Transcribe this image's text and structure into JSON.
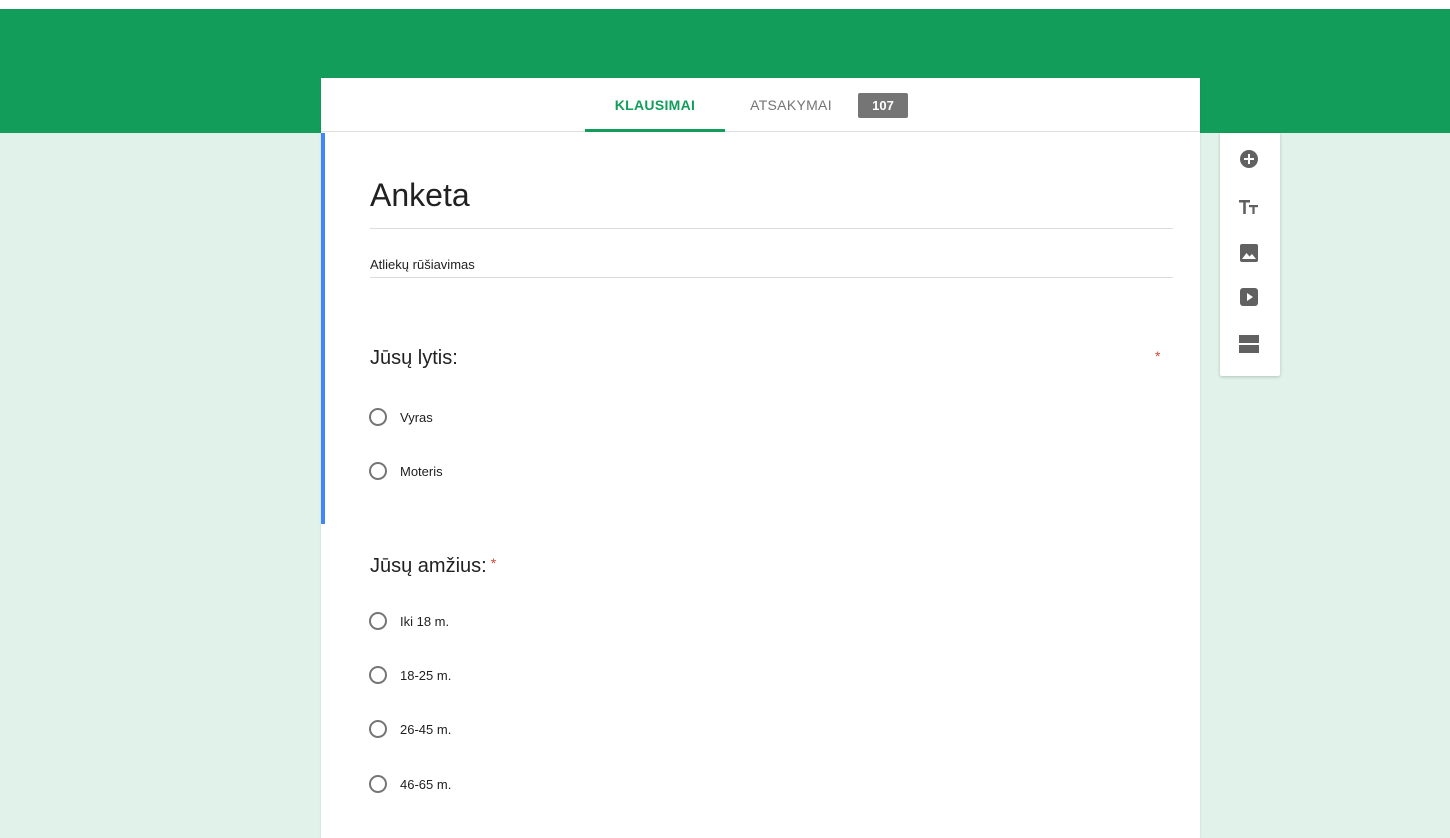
{
  "colors": {
    "header_green": "#129e5a",
    "accent_green": "#129e5a",
    "active_blue": "#4285f4",
    "tab_inactive": "#757575",
    "required_red": "#db4437"
  },
  "tabs": {
    "questions_label": "KLAUSIMAI",
    "responses_label": "ATSAKYMAI",
    "responses_count": "107"
  },
  "form": {
    "title": "Anketa",
    "description": "Atliekų rūšiavimas"
  },
  "questions": [
    {
      "title": "Jūsų lytis:",
      "required_mark": "*",
      "options": [
        "Vyras",
        "Moteris"
      ]
    },
    {
      "title": "Jūsų amžius:",
      "required_mark": "*",
      "options": [
        "Iki 18 m.",
        "18-25 m.",
        "26-45 m.",
        "46-65 m."
      ]
    }
  ],
  "sidebar": {
    "tools": [
      "add-question-icon",
      "title-text-icon",
      "image-icon",
      "video-icon",
      "section-icon"
    ]
  }
}
